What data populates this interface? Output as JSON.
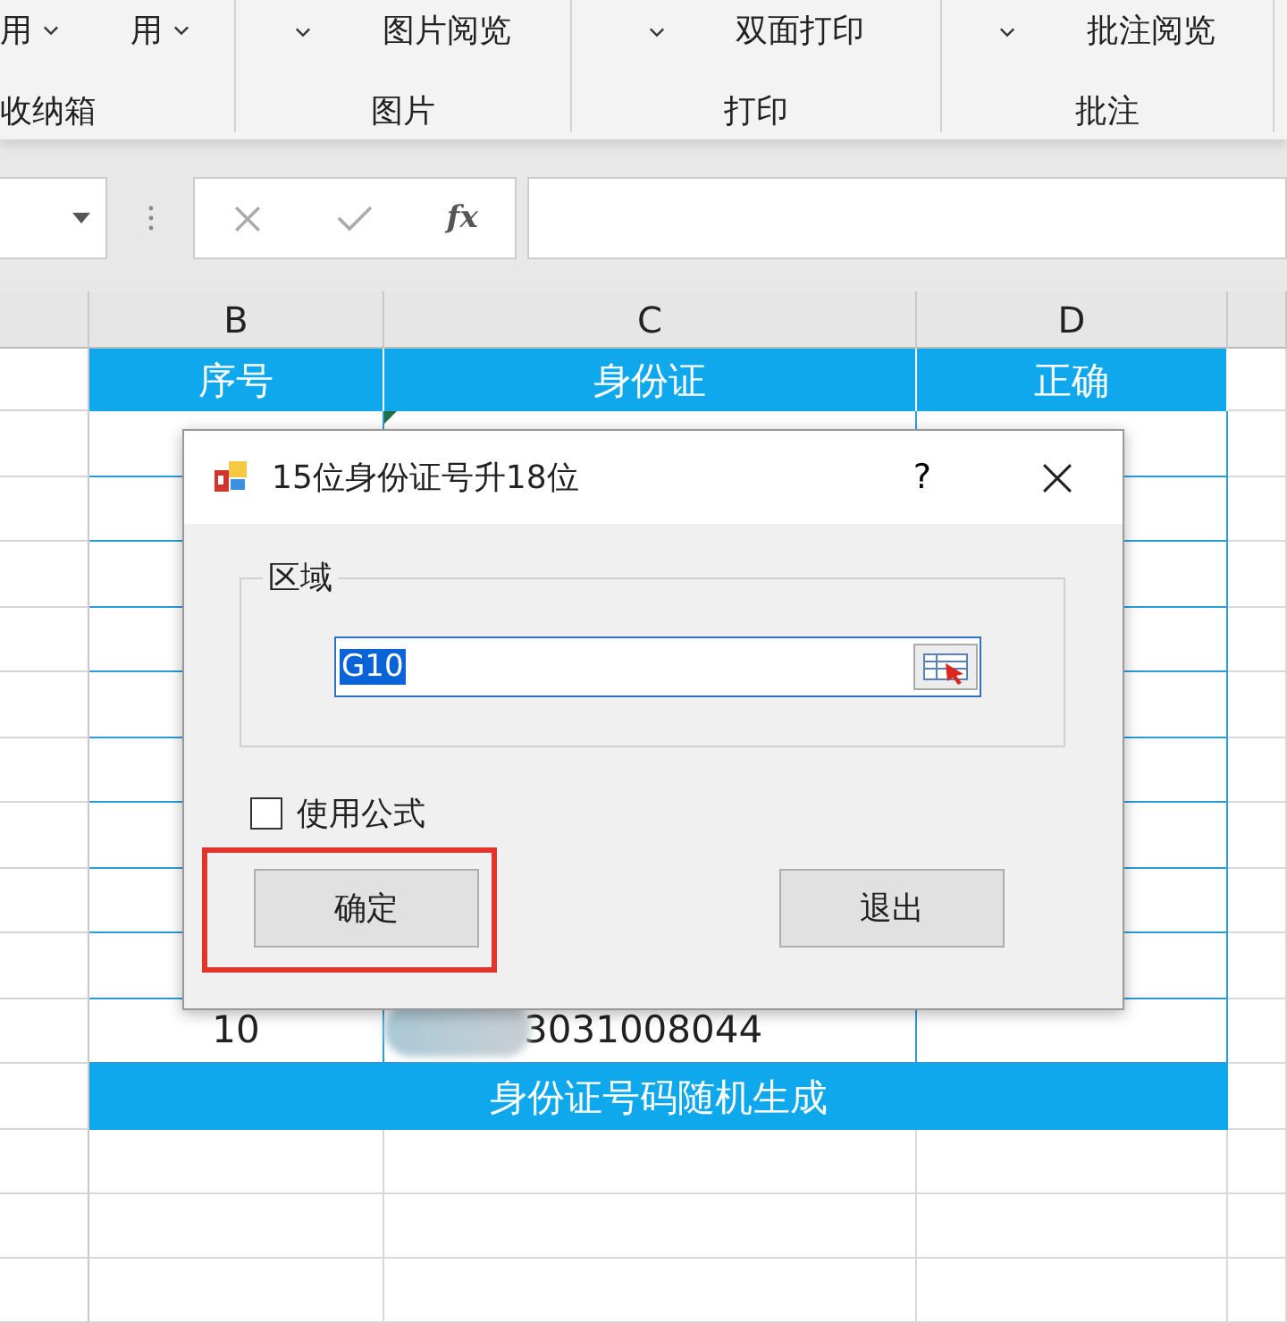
{
  "ribbon": {
    "groups": [
      {
        "label": "收纳箱",
        "items": [
          {
            "kind": "dropdown",
            "label": "用"
          },
          {
            "kind": "dropdown",
            "label": "用"
          }
        ]
      },
      {
        "label": "图片",
        "items": [
          {
            "kind": "caret"
          },
          {
            "kind": "text",
            "label": "图片阅览"
          }
        ]
      },
      {
        "label": "打印",
        "items": [
          {
            "kind": "caret"
          },
          {
            "kind": "text",
            "label": "双面打印"
          }
        ]
      },
      {
        "label": "批注",
        "items": [
          {
            "kind": "caret"
          },
          {
            "kind": "text",
            "label": "批注阅览"
          }
        ]
      }
    ]
  },
  "formula_bar": {
    "function_label": "fx"
  },
  "sheet": {
    "columns": [
      "B",
      "C",
      "D"
    ],
    "header": [
      "序号",
      "身份证",
      "正确"
    ],
    "rows": [
      {
        "number": "10",
        "id": "3031008044",
        "redacted": true
      }
    ],
    "footer": "身份证号码随机生成"
  },
  "dialog": {
    "title": "15位身份证号升18位",
    "help": "?",
    "group_label": "区域",
    "range_value": "G10",
    "range_selected": true,
    "checkbox": {
      "label": "使用公式",
      "checked": false
    },
    "buttons": [
      {
        "label": "确定",
        "highlighted": true
      },
      {
        "label": "退出",
        "highlighted": false
      }
    ]
  }
}
